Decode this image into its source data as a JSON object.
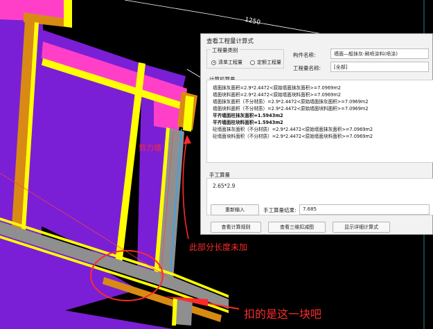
{
  "canvas": {
    "dimension_label": "1250",
    "colors": {
      "background": "#000000",
      "floor": "#7a1fd6",
      "pink": "#ff3fc8",
      "orange": "#d98a14",
      "yellow": "#ffff00",
      "wall_gray": "#8f8f8f",
      "annotation": "#ff2a2a"
    }
  },
  "dialog": {
    "title": "查看工程量计算式",
    "quantity_group": {
      "label": "工程量类别",
      "options": [
        {
          "label": "清单工程量",
          "selected": true
        },
        {
          "label": "定额工程量",
          "selected": false
        }
      ]
    },
    "component_name_label": "构件名称:",
    "component_name_value": "墙面—般抹灰-刷喷涂料(喷涂)",
    "quantity_name_label": "工程量名称:",
    "quantity_name_value": "[全部]",
    "calc_section_label": "计算机算量",
    "calc_lines": [
      "墙面抹灰面积=2.9*2.4472<原始墙面抹灰面积>=7.0969m2",
      "墙面块料面积=2.9*2.4472<原始墙面块料面积>=7.0969m2",
      "墙面抹灰面积（不分材质）=2.9*2.4472<原始墙面抹灰面积>=7.0969m2",
      "墙面块料面积（不分材质）=2.9*2.4472<原始墙面块料面积>=7.0969m2",
      "平齐墙面柱抹灰面积=1.5943m2",
      "平齐墙面柱块料面积=1.5943m2",
      "砼墙面抹灰面积（不分材质）=2.9*2.4472<原始墙面抹灰面积>=7.0969m2",
      "砼墙面块料面积（不分材质）=2.9*2.4472<原始墙面块料面积>=7.0969m2"
    ],
    "manual_section_label": "手工算量",
    "manual_formula": "2.65*2.9",
    "reenter_button": "重新输入",
    "manual_result_label": "手工算量结果:",
    "manual_result_value": "7.685",
    "bottom_buttons": [
      "查看计算规则",
      "查看三维扣减图",
      "显示详细计算式"
    ]
  },
  "annotations": {
    "shear_wall": "剪力墙",
    "length_not_added": "此部分长度未加",
    "deducted_block": "扣的是这一块吧"
  }
}
